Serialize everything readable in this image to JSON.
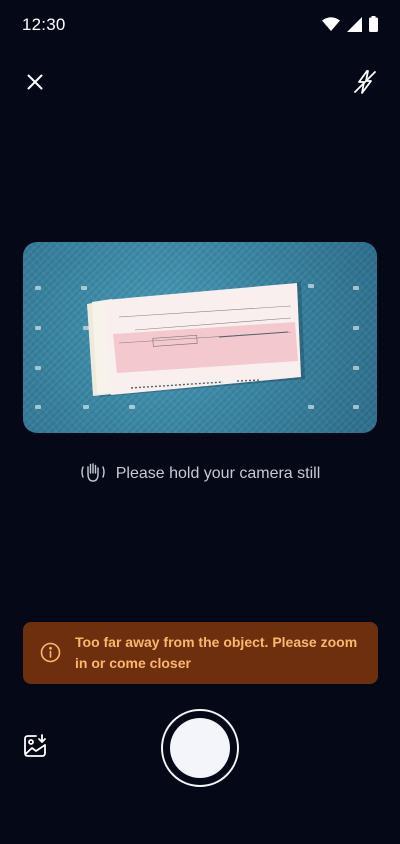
{
  "status_bar": {
    "time": "12:30"
  },
  "camera": {
    "hint_text": "Please hold your camera still",
    "warning_message": "Too far away from the object. Please zoom in or come closer"
  },
  "colors": {
    "background": "#050816",
    "warning_bg": "#6e2f0f",
    "warning_text": "#fbb869",
    "hint_text": "#c7cad3"
  },
  "icons": {
    "close": "close-icon",
    "flash": "flash-off-icon",
    "gallery": "gallery-import-icon",
    "hint": "hand-steady-icon",
    "warning": "info-icon"
  }
}
